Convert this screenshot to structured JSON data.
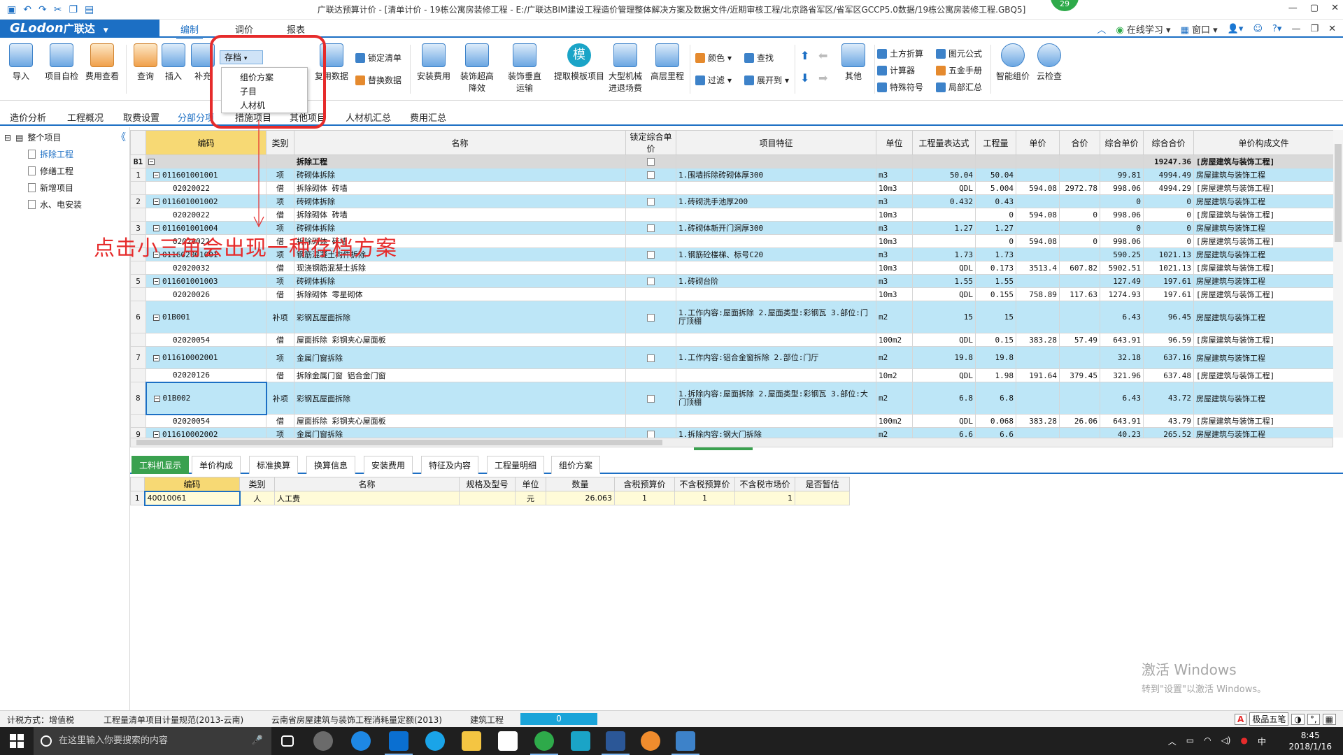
{
  "window": {
    "title": "广联达预算计价 - [清单计价 - 19栋公寓房装修工程 - E:/广联达BIM建设工程造价管理整体解决方案及数据文件/近期审核工程/北京路省军区/省军区GCCP5.0数据/19栋公寓房装修工程.GBQ5]",
    "badge": "29",
    "controls": [
      "—",
      "▢",
      "✕"
    ]
  },
  "menu": {
    "logo": "GLodon",
    "logo_cn": "广联达",
    "tabs": [
      "编制",
      "调价",
      "报表"
    ],
    "right": [
      "在线学习",
      "窗口"
    ]
  },
  "ribbon": {
    "large_buttons": [
      {
        "label": "导入"
      },
      {
        "label": "项目自检"
      },
      {
        "label": "费用查看"
      },
      {
        "label": "查询"
      },
      {
        "label": "插入"
      },
      {
        "label": "补充"
      },
      {
        "label": "复用数据"
      },
      {
        "label": "安装费用"
      },
      {
        "label": "装饰超高\n降效"
      },
      {
        "label": "装饰垂直\n运输"
      },
      {
        "label": "提取模板项目"
      },
      {
        "label": "大型机械\n进退场费"
      },
      {
        "label": "高层里程"
      },
      {
        "label": "其他"
      },
      {
        "label": "智能组价"
      },
      {
        "label": "云检查"
      }
    ],
    "small_buttons": {
      "lock_list": "锁定清单",
      "replace_data": "替换数据",
      "color": "颜色",
      "find": "查找",
      "filter": "过滤",
      "expand": "展开到",
      "earth_calc": "土方折算",
      "calculator": "计算器",
      "special_symbol": "特殊符号",
      "formula": "图元公式",
      "hardware_manual": "五金手册",
      "local_summary": "局部汇总"
    },
    "save_dropdown": {
      "label": "存档",
      "items": [
        "组价方案",
        "子目",
        "人材机"
      ]
    }
  },
  "view_tabs": [
    "造价分析",
    "工程概况",
    "取费设置",
    "分部分项",
    "措施项目",
    "其他项目",
    "人材机汇总",
    "费用汇总"
  ],
  "tree": {
    "root": "整个项目",
    "items": [
      "拆除工程",
      "修缮工程",
      "新增项目",
      "水、电安装"
    ]
  },
  "grid": {
    "columns": [
      "编码",
      "类别",
      "名称",
      "锁定综合单价",
      "项目特征",
      "单位",
      "工程量表达式",
      "工程量",
      "单价",
      "合价",
      "综合单价",
      "综合合价",
      "单价构成文件"
    ],
    "rows": [
      {
        "kind": "group",
        "rh": "B1",
        "code": "",
        "type": "",
        "name": "拆除工程",
        "feat": "",
        "unit": "",
        "expr": "",
        "qty": "",
        "price": "",
        "total": "",
        "uprice": "",
        "utotal": "19247.36",
        "file": "[房屋建筑与装饰工程]"
      },
      {
        "kind": "blue",
        "rh": "1",
        "code": "011601001001",
        "type": "项",
        "name": "砖砌体拆除",
        "feat": "1.围墙拆除砖砌体厚300",
        "unit": "m3",
        "expr": "50.04",
        "qty": "50.04",
        "price": "",
        "total": "",
        "uprice": "99.81",
        "utotal": "4994.49",
        "file": "房屋建筑与装饰工程"
      },
      {
        "kind": "white",
        "rh": "",
        "code": "02020022",
        "type": "借",
        "name": "拆除砌体 砖墙",
        "feat": "",
        "unit": "10m3",
        "expr": "QDL",
        "qty": "5.004",
        "price": "594.08",
        "total": "2972.78",
        "uprice": "998.06",
        "utotal": "4994.29",
        "file": "[房屋建筑与装饰工程]"
      },
      {
        "kind": "blue",
        "rh": "2",
        "code": "011601001002",
        "type": "项",
        "name": "砖砌体拆除",
        "feat": "1.砖砌洗手池厚200",
        "unit": "m3",
        "expr": "0.432",
        "qty": "0.43",
        "price": "",
        "total": "",
        "uprice": "0",
        "utotal": "0",
        "file": "房屋建筑与装饰工程"
      },
      {
        "kind": "white",
        "rh": "",
        "code": "02020022",
        "type": "借",
        "name": "拆除砌体 砖墙",
        "feat": "",
        "unit": "10m3",
        "expr": "",
        "qty": "0",
        "price": "594.08",
        "total": "0",
        "uprice": "998.06",
        "utotal": "0",
        "file": "[房屋建筑与装饰工程]"
      },
      {
        "kind": "blue",
        "rh": "3",
        "code": "011601001004",
        "type": "项",
        "name": "砖砌体拆除",
        "feat": "1.砖砌体新开门洞厚300",
        "unit": "m3",
        "expr": "1.27",
        "qty": "1.27",
        "price": "",
        "total": "",
        "uprice": "0",
        "utotal": "0",
        "file": "房屋建筑与装饰工程"
      },
      {
        "kind": "white",
        "rh": "",
        "code": "02020022",
        "type": "借",
        "name": "拆除砌体 砖墙",
        "feat": "",
        "unit": "10m3",
        "expr": "",
        "qty": "0",
        "price": "594.08",
        "total": "0",
        "uprice": "998.06",
        "utotal": "0",
        "file": "[房屋建筑与装饰工程]"
      },
      {
        "kind": "blue",
        "rh": "",
        "code": "011602001001",
        "type": "项",
        "name": "钢筋混凝土构件拆除",
        "feat": "1.钢筋砼楼梯、标号C20",
        "unit": "m3",
        "expr": "1.73",
        "qty": "1.73",
        "price": "",
        "total": "",
        "uprice": "590.25",
        "utotal": "1021.13",
        "file": "房屋建筑与装饰工程"
      },
      {
        "kind": "white",
        "rh": "",
        "code": "02020032",
        "type": "借",
        "name": "现浇钢筋混凝土拆除",
        "feat": "",
        "unit": "10m3",
        "expr": "QDL",
        "qty": "0.173",
        "price": "3513.4",
        "total": "607.82",
        "uprice": "5902.51",
        "utotal": "1021.13",
        "file": "[房屋建筑与装饰工程]"
      },
      {
        "kind": "blue",
        "rh": "5",
        "code": "011601001003",
        "type": "项",
        "name": "砖砌体拆除",
        "feat": "1.砖砌台阶",
        "unit": "m3",
        "expr": "1.55",
        "qty": "1.55",
        "price": "",
        "total": "",
        "uprice": "127.49",
        "utotal": "197.61",
        "file": "房屋建筑与装饰工程"
      },
      {
        "kind": "white",
        "rh": "",
        "code": "02020026",
        "type": "借",
        "name": "拆除砌体 零星砌体",
        "feat": "",
        "unit": "10m3",
        "expr": "QDL",
        "qty": "0.155",
        "price": "758.89",
        "total": "117.63",
        "uprice": "1274.93",
        "utotal": "197.61",
        "file": "[房屋建筑与装饰工程]"
      },
      {
        "kind": "blue",
        "rh": "6",
        "code": "01B001",
        "type": "补项",
        "name": "彩钢瓦屋面拆除",
        "feat": "1.工作内容:屋面拆除\n2.屋面类型:彩钢瓦\n3.部位:门厅顶棚",
        "unit": "m2",
        "expr": "15",
        "qty": "15",
        "price": "",
        "total": "",
        "uprice": "6.43",
        "utotal": "96.45",
        "file": "房屋建筑与装饰工程",
        "tall": 3
      },
      {
        "kind": "white",
        "rh": "",
        "code": "02020054",
        "type": "借",
        "name": "屋面拆除 彩钢夹心屋面板",
        "feat": "",
        "unit": "100m2",
        "expr": "QDL",
        "qty": "0.15",
        "price": "383.28",
        "total": "57.49",
        "uprice": "643.91",
        "utotal": "96.59",
        "file": "[房屋建筑与装饰工程]"
      },
      {
        "kind": "blue",
        "rh": "7",
        "code": "011610002001",
        "type": "项",
        "name": "金属门窗拆除",
        "feat": "1.工作内容:铝合金窗拆除\n2.部位:门厅",
        "unit": "m2",
        "expr": "19.8",
        "qty": "19.8",
        "price": "",
        "total": "",
        "uprice": "32.18",
        "utotal": "637.16",
        "file": "房屋建筑与装饰工程",
        "tall": 2
      },
      {
        "kind": "white",
        "rh": "",
        "code": "02020126",
        "type": "借",
        "name": "拆除金属门窗 铝合金门窗",
        "feat": "",
        "unit": "10m2",
        "expr": "QDL",
        "qty": "1.98",
        "price": "191.64",
        "total": "379.45",
        "uprice": "321.96",
        "utotal": "637.48",
        "file": "[房屋建筑与装饰工程]"
      },
      {
        "kind": "blue",
        "rh": "8",
        "code": "01B002",
        "type": "补项",
        "name": "彩钢瓦屋面拆除",
        "feat": "1.拆除内容:屋面拆除\n2.屋面类型:彩钢瓦\n3.部位:大门顶棚",
        "unit": "m2",
        "expr": "6.8",
        "qty": "6.8",
        "price": "",
        "total": "",
        "uprice": "6.43",
        "utotal": "43.72",
        "file": "房屋建筑与装饰工程",
        "tall": 3,
        "selected": true
      },
      {
        "kind": "white",
        "rh": "",
        "code": "02020054",
        "type": "借",
        "name": "屋面拆除 彩钢夹心屋面板",
        "feat": "",
        "unit": "100m2",
        "expr": "QDL",
        "qty": "0.068",
        "price": "383.28",
        "total": "26.06",
        "uprice": "643.91",
        "utotal": "43.79",
        "file": "[房屋建筑与装饰工程]"
      },
      {
        "kind": "blue",
        "rh": "9",
        "code": "011610002002",
        "type": "项",
        "name": "金属门窗拆除",
        "feat": "1.拆除内容:钢大门拆除",
        "unit": "m2",
        "expr": "6.6",
        "qty": "6.6",
        "price": "",
        "total": "",
        "uprice": "40.23",
        "utotal": "265.52",
        "file": "房屋建筑与装饰工程"
      }
    ]
  },
  "annotation": "点击小三角会出现一种存档方案",
  "bottom_tabs": [
    "工料机显示",
    "单价构成",
    "标准换算",
    "换算信息",
    "安装费用",
    "特征及内容",
    "工程量明细",
    "组价方案"
  ],
  "sub_grid": {
    "columns": [
      "编码",
      "类别",
      "名称",
      "规格及型号",
      "单位",
      "数量",
      "含税预算价",
      "不含税预算价",
      "不含税市场价",
      "是否暂估"
    ],
    "rows": [
      {
        "rh": "1",
        "code": "40010061",
        "type": "人",
        "name": "人工费",
        "spec": "",
        "unit": "元",
        "qty": "26.063",
        "p1": "1",
        "p2": "1",
        "p3": "1",
        "est": ""
      }
    ]
  },
  "watermark": {
    "line1": "激活 Windows",
    "line2": "转到\"设置\"以激活 Windows。"
  },
  "status": {
    "tax": "计税方式：增值税",
    "spec": "工程量清单项目计量规范(2013-云南)",
    "quota": "云南省房屋建筑与装饰工程消耗量定额(2013)",
    "major": "建筑工程",
    "progress": "0",
    "ime": "极品五笔"
  },
  "taskbar": {
    "search_placeholder": "在这里输入你要搜索的内容",
    "time": "8:45",
    "date": "2018/1/16"
  }
}
